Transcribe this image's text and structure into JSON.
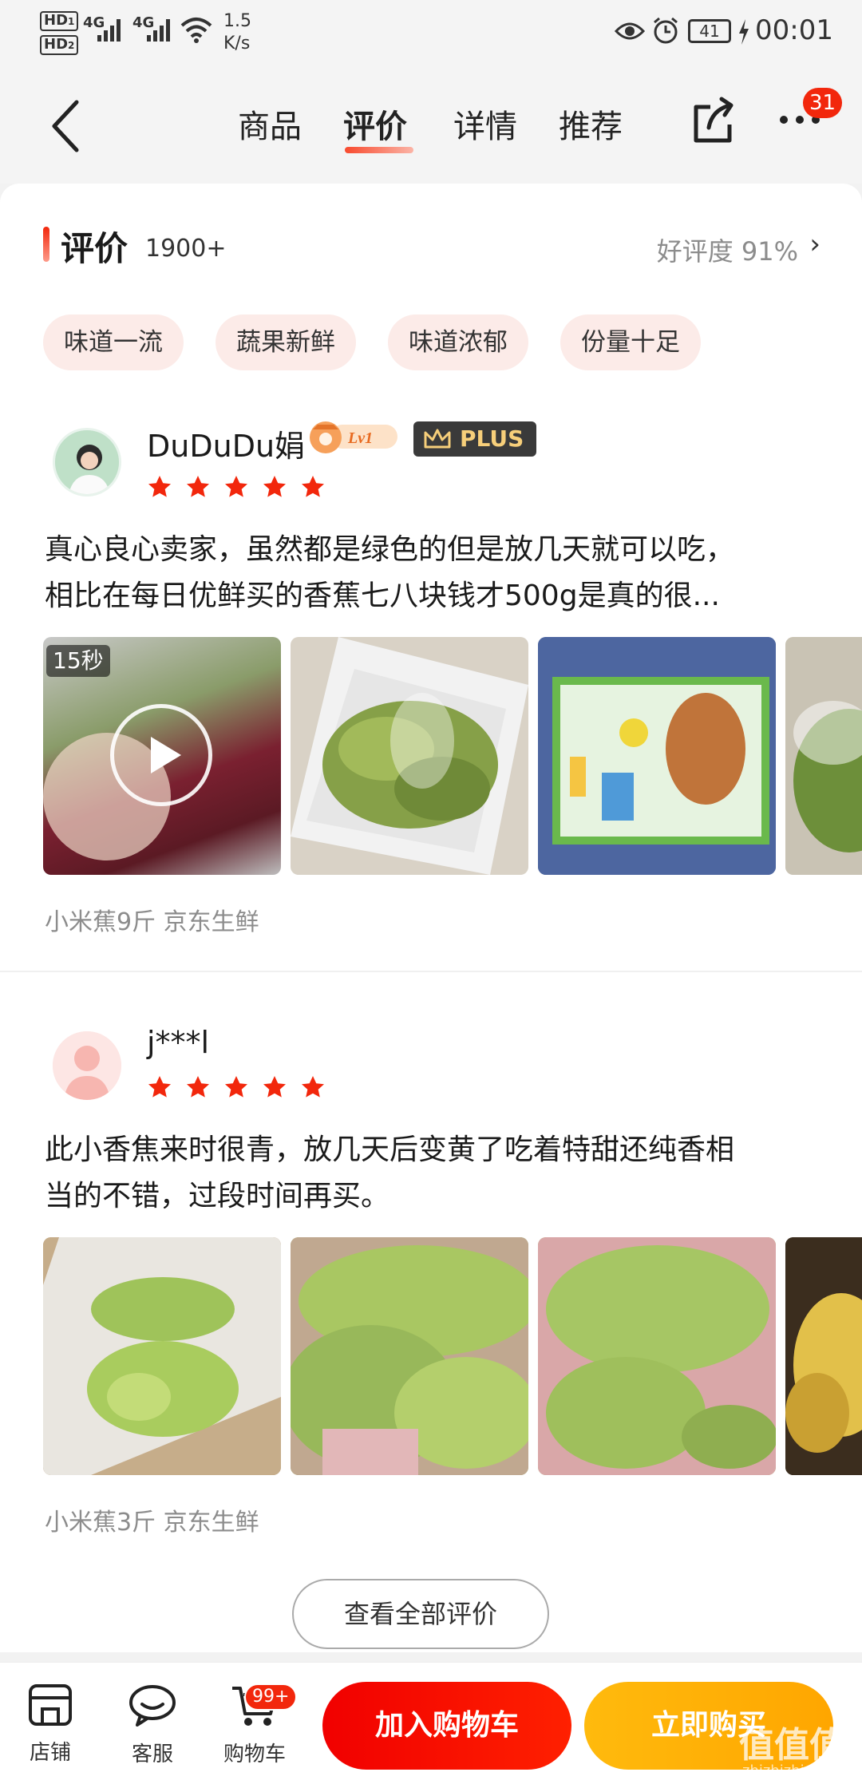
{
  "status_bar": {
    "hd1": "HD",
    "hd1_sub": "1",
    "hd2": "HD",
    "hd2_sub": "2",
    "net1": "4G",
    "net2": "4G",
    "speed_value": "1.5",
    "speed_unit": "K/s",
    "battery": "41",
    "time": "00:01"
  },
  "nav": {
    "tabs": [
      {
        "label": "商品"
      },
      {
        "label": "评价"
      },
      {
        "label": "详情"
      },
      {
        "label": "推荐"
      }
    ],
    "active_tab": "评价",
    "more_badge": "31"
  },
  "reviews_section": {
    "title": "评价",
    "count": "1900+",
    "good_rate": "好评度 91%",
    "tags": [
      "味道一流",
      "蔬果新鲜",
      "味道浓郁",
      "份量十足"
    ]
  },
  "reviews": [
    {
      "username": "DuDuDu娟",
      "level_badge": "Lv1",
      "plus_badge": "PLUS",
      "stars": 5,
      "text_line1": "真心良心卖家，虽然都是绿色的但是放几天就可以吃，",
      "text_line2": "相比在每日优鲜买的香蕉七八块钱才500g是真的很...",
      "video_duration": "15秒",
      "spec": "小米蕉9斤  京东生鲜"
    },
    {
      "username": "j***l",
      "stars": 5,
      "text_line1": "此小香焦来时很青，放几天后变黄了吃着特甜还纯香相",
      "text_line2": "当的不错，过段时间再买。",
      "spec": "小米蕉3斤  京东生鲜"
    }
  ],
  "view_all": "查看全部评价",
  "bottom_bar": {
    "store": "店铺",
    "service": "客服",
    "cart": "购物车",
    "cart_badge": "99+",
    "add_to_cart": "加入购物车",
    "buy_now": "立即购买"
  },
  "watermark": {
    "logo": "值值值",
    "url": "zhizhizhi.com"
  },
  "colors": {
    "accent": "#f2270c",
    "buy": "#ffa600",
    "star": "#f2270c"
  }
}
